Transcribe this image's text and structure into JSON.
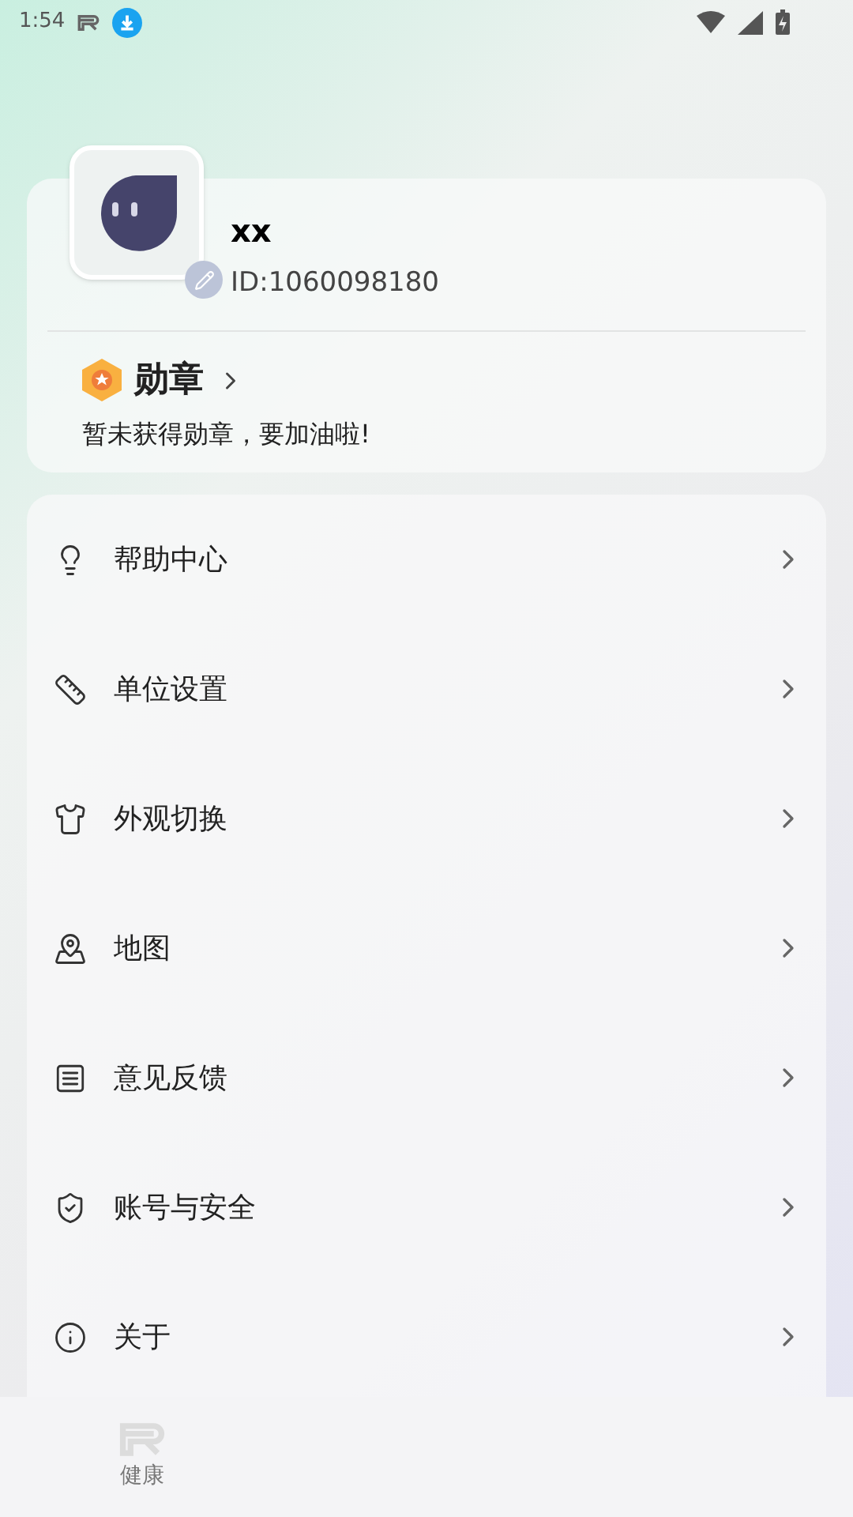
{
  "status_bar": {
    "time": "1:54"
  },
  "profile": {
    "name": "xx",
    "id": "ID:1060098180",
    "badges_title": "勋章",
    "badges_note": "暂未获得勋章，要加油啦!"
  },
  "menu": [
    {
      "label": "帮助中心"
    },
    {
      "label": "单位设置"
    },
    {
      "label": "外观切换"
    },
    {
      "label": "地图"
    },
    {
      "label": "意见反馈"
    },
    {
      "label": "账号与安全"
    },
    {
      "label": "关于"
    }
  ],
  "bottom_nav": [
    {
      "label": "健康",
      "selected": false
    }
  ]
}
